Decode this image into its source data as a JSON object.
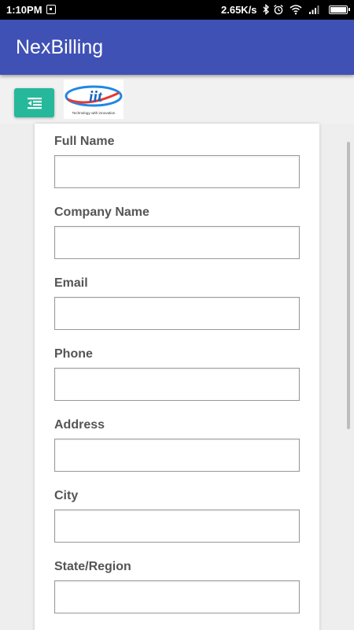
{
  "status_bar": {
    "time": "1:10PM",
    "speed": "2.65K/s",
    "icons": [
      "notification-icon",
      "bluetooth-icon",
      "alarm-icon",
      "wifi-icon",
      "signal-icon",
      "battery-icon"
    ]
  },
  "app_bar": {
    "title": "NexBilling",
    "background_color": "#3f51b5"
  },
  "toolbar": {
    "menu_button_icon": "menu-collapse-icon",
    "menu_button_color": "#26b89a",
    "logo": {
      "text": "iit",
      "tagline": "Technology with innovation"
    }
  },
  "form": {
    "fields": [
      {
        "label": "Full Name",
        "value": "",
        "placeholder": ""
      },
      {
        "label": "Company Name",
        "value": "",
        "placeholder": ""
      },
      {
        "label": "Email",
        "value": "",
        "placeholder": ""
      },
      {
        "label": "Phone",
        "value": "",
        "placeholder": ""
      },
      {
        "label": "Address",
        "value": "",
        "placeholder": ""
      },
      {
        "label": "City",
        "value": "",
        "placeholder": ""
      },
      {
        "label": "State/Region",
        "value": "",
        "placeholder": ""
      }
    ]
  }
}
